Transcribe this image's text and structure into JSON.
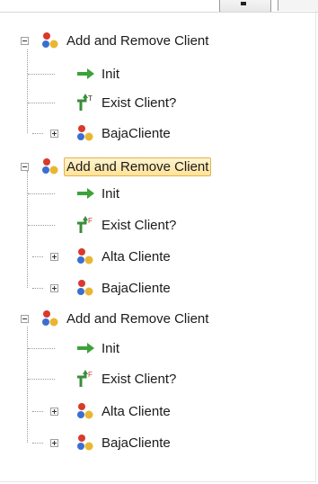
{
  "colors": {
    "selection_fill": "#ffe7a8",
    "selection_border": "#e4b24c",
    "arrow_green": "#3ca23a",
    "tree_line": "#9a9a9a"
  },
  "tree": [
    {
      "label": "Add and Remove Client",
      "icon": "group-nodes-icon",
      "expanded": true,
      "selected": false,
      "children": [
        {
          "label": "Init",
          "icon": "green-arrow-icon",
          "expander": false
        },
        {
          "label": "Exist Client?",
          "icon": "decision-true-icon",
          "badge": "T",
          "expander": false
        },
        {
          "label": "BajaCliente",
          "icon": "group-nodes-icon",
          "expander": "collapsed"
        }
      ]
    },
    {
      "label": "Add and Remove Client",
      "icon": "group-nodes-icon",
      "expanded": true,
      "selected": true,
      "children": [
        {
          "label": "Init",
          "icon": "green-arrow-icon",
          "expander": false
        },
        {
          "label": "Exist Client?",
          "icon": "decision-false-icon",
          "badge": "F",
          "expander": false
        },
        {
          "label": "Alta Cliente",
          "icon": "group-nodes-icon",
          "expander": "collapsed"
        },
        {
          "label": "BajaCliente",
          "icon": "group-nodes-icon",
          "expander": "collapsed"
        }
      ]
    },
    {
      "label": "Add and Remove Client",
      "icon": "group-nodes-icon",
      "expanded": true,
      "selected": false,
      "children": [
        {
          "label": "Init",
          "icon": "green-arrow-icon",
          "expander": false
        },
        {
          "label": "Exist Client?",
          "icon": "decision-false-icon",
          "badge": "F",
          "expander": false
        },
        {
          "label": "Alta Cliente",
          "icon": "group-nodes-icon",
          "expander": "collapsed"
        },
        {
          "label": "BajaCliente",
          "icon": "group-nodes-icon",
          "expander": "collapsed"
        }
      ]
    }
  ]
}
